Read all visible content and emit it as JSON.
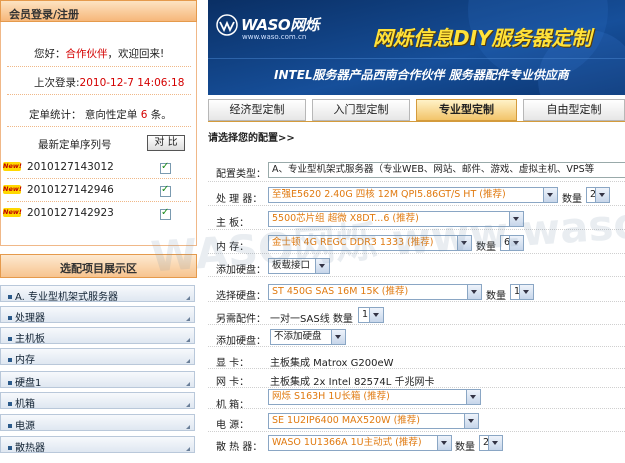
{
  "login": {
    "title": "会员登录/注册",
    "greeting_prefix": "您好：",
    "member_type": "合作伙伴",
    "greeting_suffix": "，欢迎回来!",
    "last_login_label": "上次登录:",
    "last_login_time": "2010-12-7 14:06:18",
    "order_stats_label": "定单统计：",
    "order_stats_text": "意向性定单",
    "order_count": "6",
    "order_count_unit": "条。",
    "latest_orders_label": "最新定单序列号",
    "compare_button": "对 比",
    "new_badge": "New!",
    "orders": [
      "2010127143012",
      "2010127142946",
      "2010127142923"
    ]
  },
  "menu": {
    "title": "选配项目展示区",
    "items": [
      "A. 专业型机架式服务器",
      "处理器",
      "主机板",
      "内存",
      "硬盘1",
      "机箱",
      "电源",
      "散热器"
    ]
  },
  "banner": {
    "logo": "WASO网烁",
    "logo_url": "www.waso.com.cn",
    "headline": "网烁信息DIY服务器定制",
    "subline": "INTEL服务器产品西南合作伙伴 服务器配件专业供应商"
  },
  "tabs": [
    "经济型定制",
    "入门型定制",
    "专业型定制",
    "自由型定制"
  ],
  "active_tab": 2,
  "config": {
    "prompt": "请选择您的配置>>",
    "type_label": "配置类型：",
    "type_value": "A、专业型机架式服务器（专业WEB、网站、邮件、游戏、虚拟主机、VPS等",
    "rows": [
      {
        "label": "处 理 器：",
        "value": "至强E5620 2.40G 四核 12M QPI5.86GT/S HT  (推荐)",
        "qty_label": "数量",
        "qty": "2"
      },
      {
        "label": "主    板：",
        "value": "5500芯片组 超微 X8DT...6  (推荐)"
      },
      {
        "label": "内    存：",
        "value": "金士顿 4G REGC DDR3 1333  (推荐)",
        "qty_label": "数量",
        "qty": "6"
      },
      {
        "label": "添加硬盘：",
        "value": "板载接口"
      },
      {
        "label": "选择硬盘：",
        "value": "ST 450G SAS 16M 15K  (推荐)",
        "qty_label": "数量",
        "qty": "1"
      },
      {
        "label": "另需配件：",
        "value_prefix": "一对一SAS线 数量",
        "value": "1"
      },
      {
        "label": "添加硬盘：",
        "value": "不添加硬盘"
      },
      {
        "label": "显    卡：",
        "text": "主板集成 Matrox G200eW"
      },
      {
        "label": "网    卡：",
        "text": "主板集成 2x Intel 82574L 千兆网卡"
      },
      {
        "label": "机    箱：",
        "value": "网烁 S163H 1U长箱  (推荐)"
      },
      {
        "label": "电    源：",
        "value": "SE 1U2IP6400 MAX520W  (推荐)"
      },
      {
        "label": "散 热 器：",
        "value": "WASO 1U1366A 1U主动式  (推荐)",
        "qty_label": "数量",
        "qty": "2"
      }
    ]
  },
  "watermark": "WASO网烁 www.waso.com.cn",
  "colors": {
    "accent": "#e07a10",
    "red": "#d40000",
    "banner_bg": "#0c3c78",
    "headline": "#ffe23a"
  }
}
